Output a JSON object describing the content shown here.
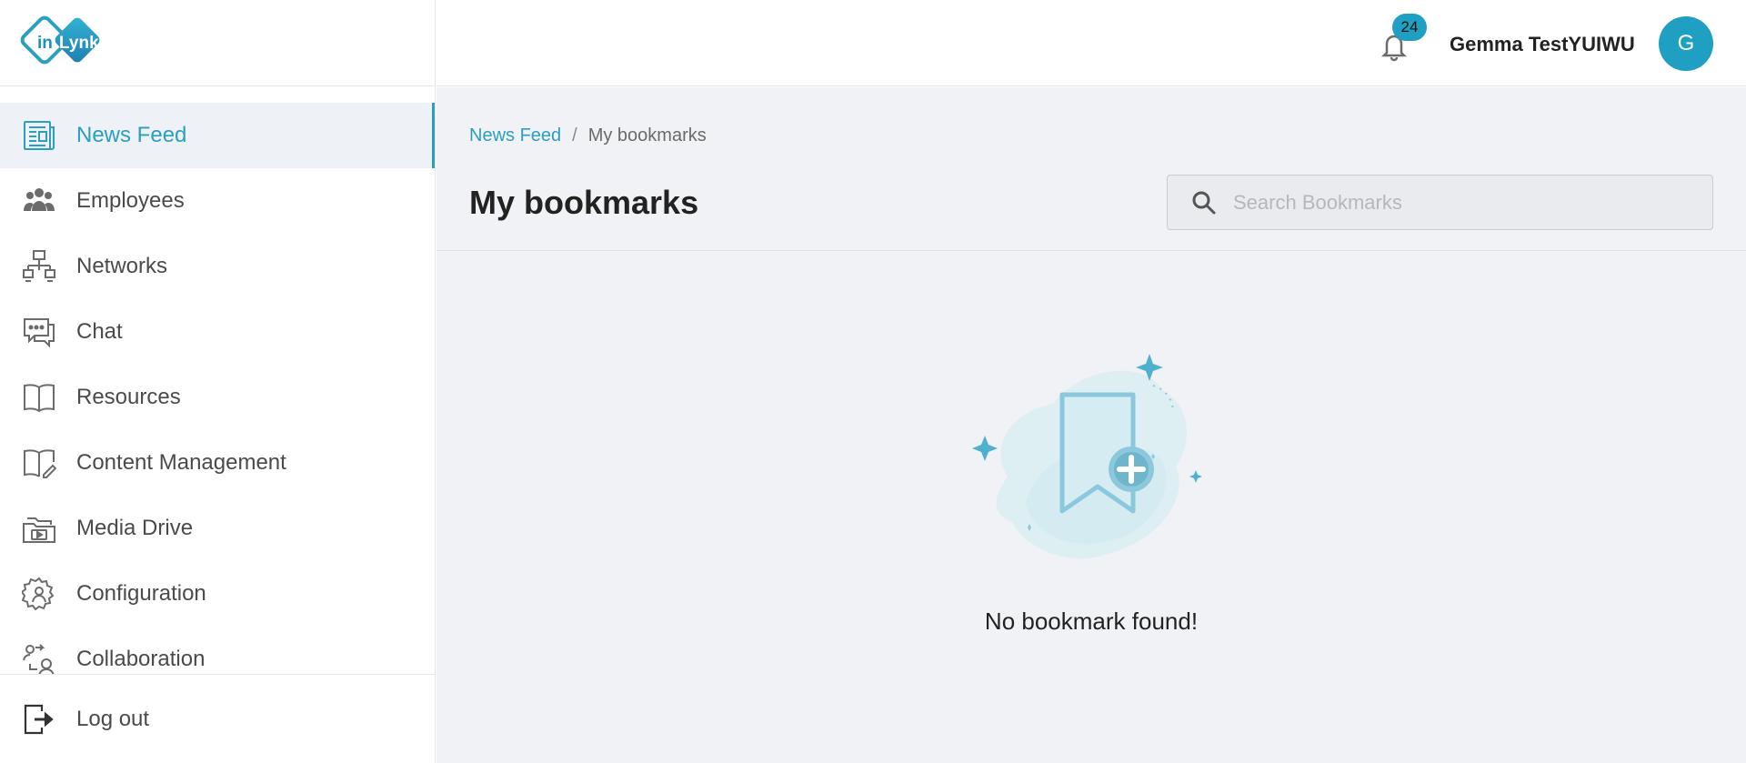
{
  "brand": {
    "logo_text_left": "in",
    "logo_text_right": "Lynk",
    "accent": "#2a9fc0"
  },
  "sidebar": {
    "items": [
      {
        "label": "News Feed",
        "icon": "newspaper-icon",
        "active": true
      },
      {
        "label": "Employees",
        "icon": "people-icon",
        "active": false
      },
      {
        "label": "Networks",
        "icon": "network-icon",
        "active": false
      },
      {
        "label": "Chat",
        "icon": "chat-icon",
        "active": false
      },
      {
        "label": "Resources",
        "icon": "book-icon",
        "active": false
      },
      {
        "label": "Content Management",
        "icon": "book-edit-icon",
        "active": false
      },
      {
        "label": "Media Drive",
        "icon": "media-folder-icon",
        "active": false
      },
      {
        "label": "Configuration",
        "icon": "gear-user-icon",
        "active": false
      },
      {
        "label": "Collaboration",
        "icon": "collaboration-icon",
        "active": false
      }
    ],
    "logout_label": "Log out"
  },
  "header": {
    "notification_count": "24",
    "user_name": "Gemma TestYUIWU",
    "avatar_initial": "G"
  },
  "main": {
    "breadcrumb": {
      "link": "News Feed",
      "separator": "/",
      "current": "My bookmarks"
    },
    "title": "My bookmarks",
    "search": {
      "placeholder": "Search Bookmarks",
      "value": ""
    },
    "empty_message": "No bookmark found!"
  }
}
